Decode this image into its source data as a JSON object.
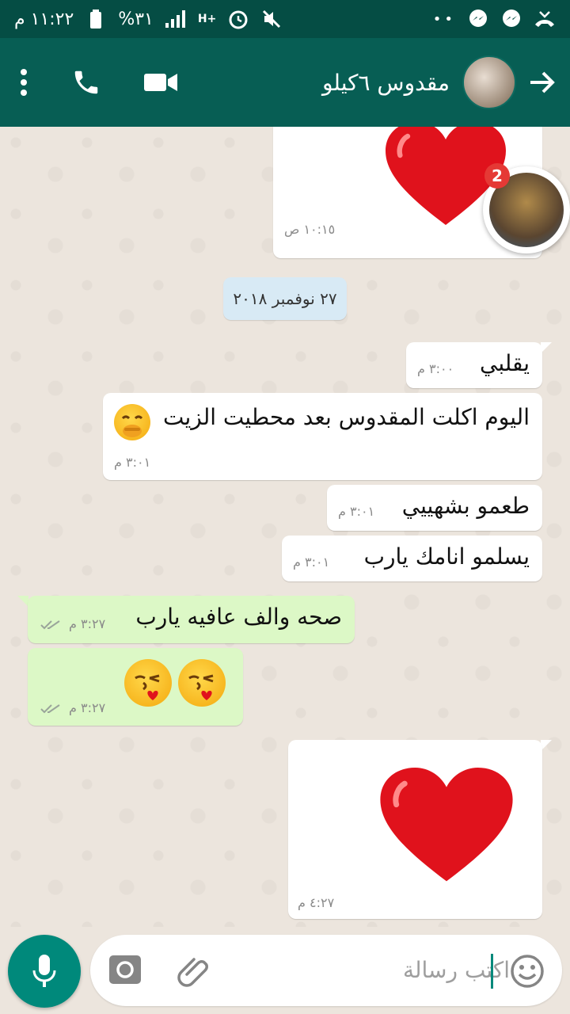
{
  "status_bar": {
    "time": "١١:٢٢ م",
    "battery": "%٣١",
    "network": "H+"
  },
  "header": {
    "contact_name": "مقدوس ٦كيلو",
    "icons": [
      "back-arrow-icon",
      "avatar",
      "video-call-icon",
      "phone-icon",
      "more-vert-icon"
    ]
  },
  "chat": {
    "date_divider": "٢٧ نوفمبر ٢٠١٨",
    "floating_badge_count": "2",
    "messages": [
      {
        "direction": "in",
        "type": "sticker",
        "sticker": "red-heart",
        "time": "١٠:١٥ ص"
      },
      {
        "direction": "in",
        "type": "text",
        "text": "يقلبي",
        "time": "٣:٠٠ م"
      },
      {
        "direction": "in",
        "type": "text",
        "text": "اليوم اكلت المقدوس بعد محطيت الزيت",
        "emoji": "hand-over-mouth-face",
        "time": "٣:٠١ م"
      },
      {
        "direction": "in",
        "type": "text",
        "text": "طعمو بشهييي",
        "time": "٣:٠١ م"
      },
      {
        "direction": "in",
        "type": "text",
        "text": "يسلمو انامك يارب",
        "time": "٣:٠١ م"
      },
      {
        "direction": "out",
        "type": "text",
        "text": "صحه والف عافيه يارب",
        "time": "٣:٢٧ م"
      },
      {
        "direction": "out",
        "type": "emoji",
        "emoji": [
          "kissing-face",
          "kissing-face"
        ],
        "time": "٣:٢٧ م"
      },
      {
        "direction": "in",
        "type": "sticker",
        "sticker": "red-heart",
        "time": "٤:٢٧ م"
      }
    ]
  },
  "input": {
    "placeholder": "اكتب رسالة",
    "icons": [
      "emoji-icon",
      "attach-icon",
      "camera-icon",
      "mic-icon"
    ]
  },
  "colors": {
    "status_bar": "#054d44",
    "header": "#075e54",
    "chat_bg": "#ece5dd",
    "incoming_bubble": "#ffffff",
    "outgoing_bubble": "#dcf8c6",
    "date_chip": "#d8eaf5",
    "accent": "#00897b",
    "badge": "#e53935"
  }
}
